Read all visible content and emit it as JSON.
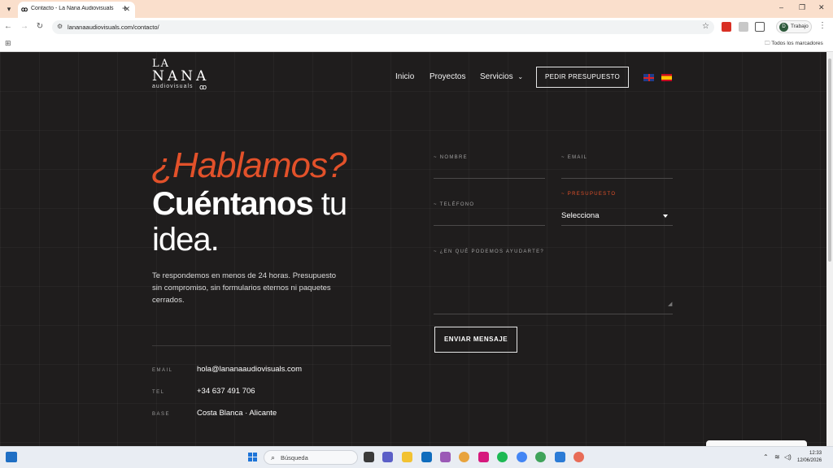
{
  "browser": {
    "tab_title": "Contacto - La Nana Audiovisuals",
    "url": "lananaaudiovisuals.com/contacto/",
    "profile_label": "Trabajo",
    "profile_initial": "D",
    "bookmarks_label": "Todos los marcadores"
  },
  "site": {
    "logo": {
      "line1": "LA",
      "line2": "NANA",
      "line3": "audiovisuals"
    },
    "nav": [
      {
        "label": "Inicio"
      },
      {
        "label": "Proyectos"
      },
      {
        "label": "Servicios"
      }
    ],
    "cta_label": "PEDIR PRESUPUESTO",
    "languages": [
      "en",
      "es"
    ]
  },
  "hero": {
    "headline_accent": "¿Hablamos?",
    "headline_bold": "Cuéntanos",
    "headline_rest": " tu",
    "headline_line3": "idea.",
    "lead": "Te respondemos en menos de 24 horas. Presupuesto sin compromiso, sin formularios eternos ni paquetes cerrados."
  },
  "contact": [
    {
      "key": "EMAIL",
      "value": "hola@lananaaudiovisuals.com"
    },
    {
      "key": "TEL",
      "value": "+34 637 491 706"
    },
    {
      "key": "BASE",
      "value": "Costa Blanca · Alicante"
    }
  ],
  "form": {
    "name_label": "~ NOMBRE",
    "email_label": "~ EMAIL",
    "phone_label": "~ TELÉFONO",
    "budget_label": "~ PRESUPUESTO",
    "budget_selected": "Selecciona",
    "message_label": "~ ¿EN QUÉ PODEMOS AYUDARTE?",
    "submit_label": "ENVIAR MENSAJE"
  },
  "taskbar": {
    "search_placeholder": "Búsqueda",
    "time": "12:33",
    "date": "12/06/2026"
  },
  "colors": {
    "accent": "#e2512a",
    "page_bg": "#1f1d1d",
    "tabbar_bg": "#fadfcc"
  }
}
